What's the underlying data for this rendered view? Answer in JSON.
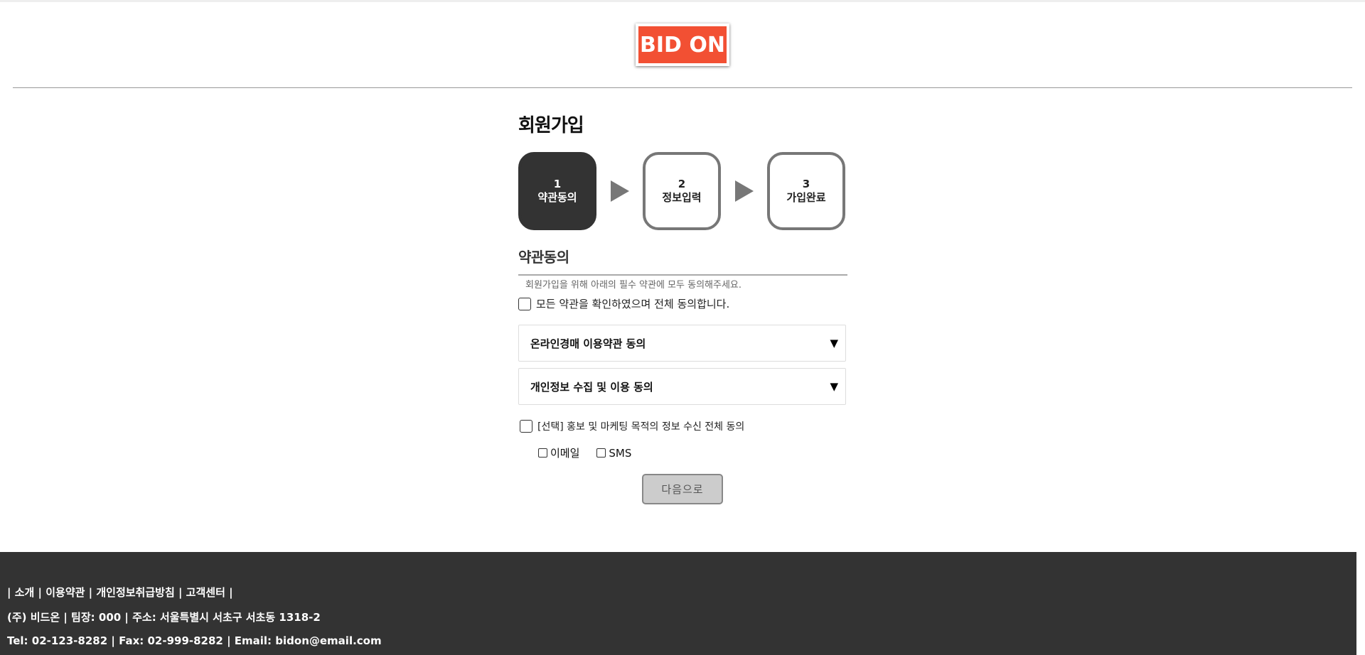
{
  "header": {
    "logo_text": "BID ON"
  },
  "page": {
    "title": "회원가입"
  },
  "steps": [
    {
      "number": "1",
      "label": "약관동의"
    },
    {
      "number": "2",
      "label": "정보입력"
    },
    {
      "number": "3",
      "label": "가입완료"
    }
  ],
  "terms": {
    "section_title": "약관동의",
    "description": "회원가입을 위해 아래의 필수 약관에 모두 동의해주세요.",
    "agree_all_label": "모든 약관을 확인하였으며 전체 동의합니다.",
    "items": [
      {
        "label": "온라인경매 이용약관 동의",
        "icon": "▼"
      },
      {
        "label": "개인정보 수집 및 이용 동의",
        "icon": "▼"
      }
    ],
    "marketing_label": "[선택] 홍보 및 마케팅 목적의 정보 수신 전체 동의",
    "channels": [
      "이메일",
      "SMS"
    ],
    "next_button": "다음으로"
  },
  "footer": {
    "links": "| 소개 | 이용약관 | 개인정보취급방침 | 고객센터 |",
    "company": "(주) 비드온 | 팀장: 000 | 주소: 서울특별시 서초구 서초동 1318-2",
    "contact": "Tel: 02-123-8282 | Fax: 02-999-8282 | Email: bidon@email.com"
  },
  "colors": {
    "logo_bg": "#f25033",
    "active_step": "#333333",
    "footer_bg": "#333333",
    "button_bg": "#cccccc"
  }
}
